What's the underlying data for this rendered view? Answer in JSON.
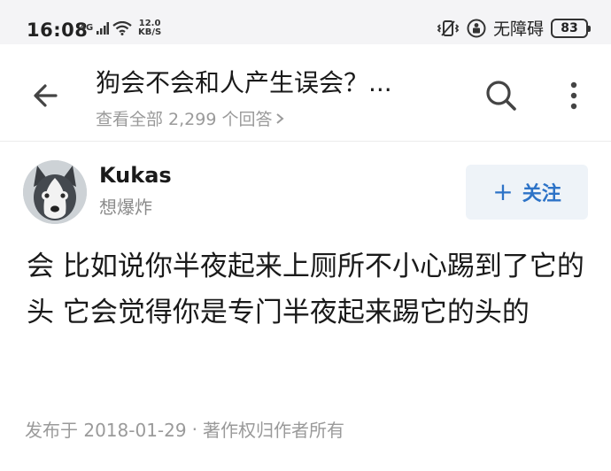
{
  "status_bar": {
    "time": "16:08",
    "network": "4G",
    "speed_value": "12.0",
    "speed_unit": "KB/S",
    "accessibility_label": "无障碍",
    "battery": "83"
  },
  "header": {
    "question_title": "狗会不会和人产生误会？...",
    "answers_link": "查看全部 2,299 个回答",
    "icons": {
      "back": "back-arrow-icon",
      "search": "search-icon",
      "more": "more-vertical-icon"
    }
  },
  "answer": {
    "author_name": "Kukas",
    "author_headline": "想爆炸",
    "follow_label": "关注",
    "content": "会 比如说你半夜起来上厕所不小心踢到了它的头 它会觉得你是专门半夜起来踢它的头的",
    "published": "发布于 2018-01-29",
    "copyright": "著作权归作者所有"
  },
  "colors": {
    "accent": "#2d73c7",
    "follow_bg": "#eef3f8",
    "muted_text": "#9a9a9a",
    "status_bar_bg": "#f4f4f6"
  }
}
